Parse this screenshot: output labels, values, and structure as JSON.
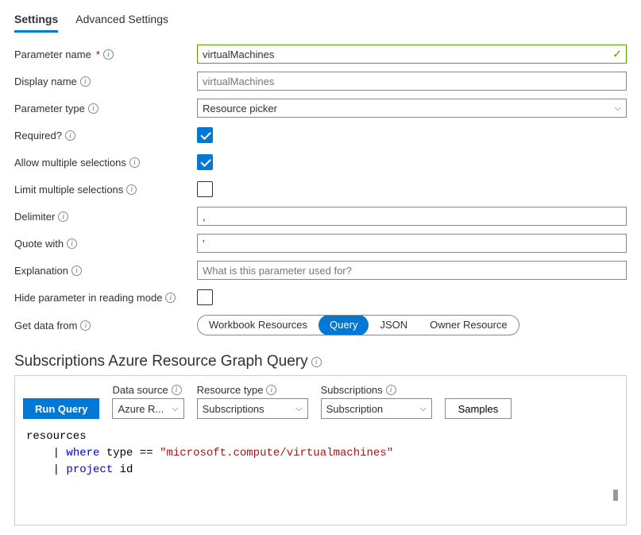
{
  "tabs": {
    "settings": "Settings",
    "advanced": "Advanced Settings"
  },
  "labels": {
    "param_name": "Parameter name",
    "display_name": "Display name",
    "param_type": "Parameter type",
    "required": "Required?",
    "allow_multi": "Allow multiple selections",
    "limit_multi": "Limit multiple selections",
    "delimiter": "Delimiter",
    "quote_with": "Quote with",
    "explanation": "Explanation",
    "hide_param": "Hide parameter in reading mode",
    "get_data": "Get data from"
  },
  "values": {
    "param_name": "virtualMachines",
    "display_name_placeholder": "virtualMachines",
    "param_type": "Resource picker",
    "delimiter": ",",
    "quote_with": "'",
    "explanation_placeholder": "What is this parameter used for?"
  },
  "data_source_pills": {
    "wb": "Workbook Resources",
    "query": "Query",
    "json": "JSON",
    "owner": "Owner Resource"
  },
  "section_title": "Subscriptions Azure Resource Graph Query",
  "toolbar": {
    "run": "Run Query",
    "ds_label": "Data source",
    "ds_value": "Azure R...",
    "rt_label": "Resource type",
    "rt_value": "Subscriptions",
    "sub_label": "Subscriptions",
    "sub_value": "Subscription",
    "samples": "Samples"
  },
  "query": {
    "line1": "resources",
    "line2_pre": "| ",
    "line2_kw1": "where",
    "line2_mid": " type == ",
    "line2_str": "\"microsoft.compute/virtualmachines\"",
    "line3_pre": "| ",
    "line3_kw1": "project",
    "line3_rest": " id"
  }
}
